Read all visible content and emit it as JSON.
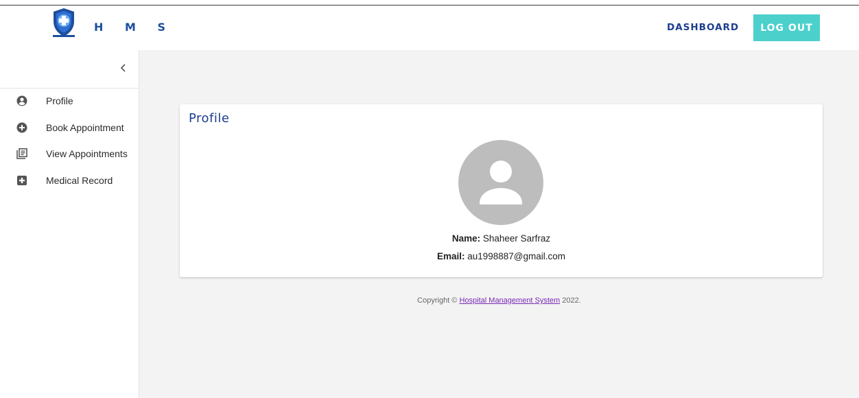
{
  "header": {
    "brand": "H M S",
    "nav_dashboard": "DASHBOARD",
    "logout_label": "LOG OUT",
    "logo_icon": "shield-plus-icon",
    "accent_color": "#4bd0cc",
    "brand_color": "#1d4e9e"
  },
  "sidebar": {
    "collapse_icon": "chevron-left-icon",
    "items": [
      {
        "label": "Profile",
        "icon": "account-circle-icon"
      },
      {
        "label": "Book Appointment",
        "icon": "add-circle-icon"
      },
      {
        "label": "View Appointments",
        "icon": "library-books-icon"
      },
      {
        "label": "Medical Record",
        "icon": "medical-plus-box-icon"
      }
    ]
  },
  "profile": {
    "title": "Profile",
    "avatar_icon": "person-avatar-icon",
    "name_label": "Name:",
    "name_value": "Shaheer Sarfraz",
    "email_label": "Email:",
    "email_value": "au1998887@gmail.com"
  },
  "footer": {
    "prefix": "Copyright ©",
    "link_text": "Hospital Management System",
    "suffix": "2022.",
    "link_color": "#7a28b5"
  }
}
